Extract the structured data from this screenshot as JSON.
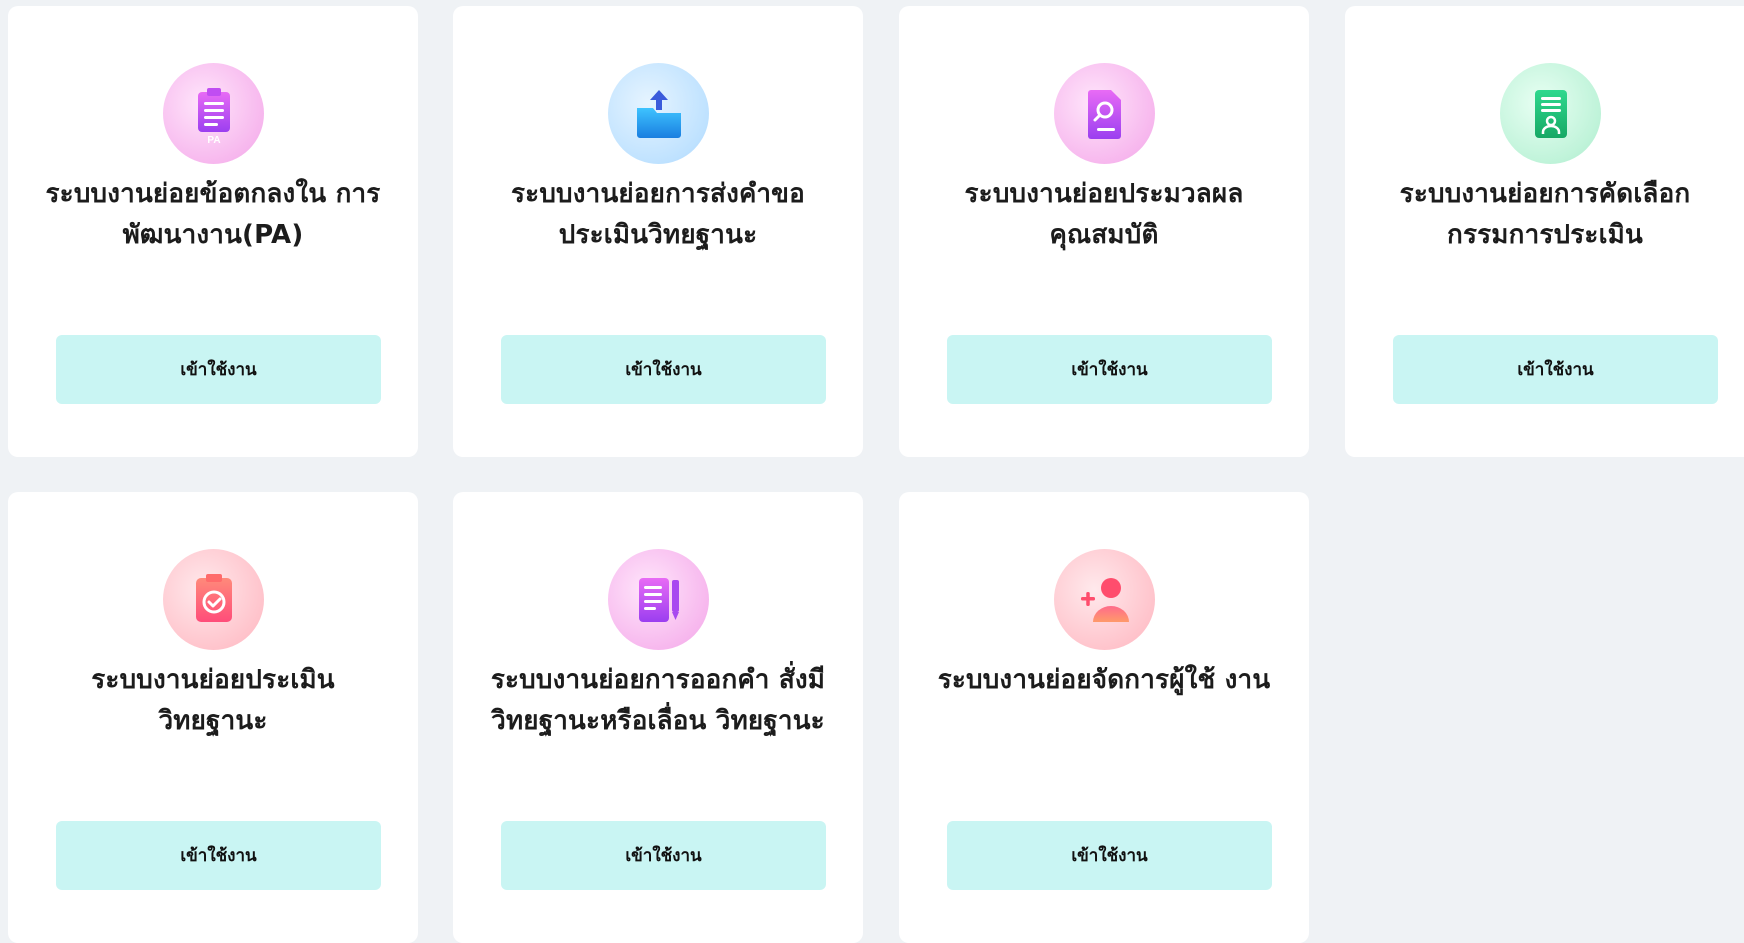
{
  "cards": [
    {
      "title": "ระบบงานย่อยข้อตกลงใน การพัฒนางาน(PA)",
      "button_label": "เข้าใช้งาน",
      "icon": "clipboard-pa-icon",
      "icon_badge": "PA"
    },
    {
      "title": "ระบบงานย่อยการส่งคำขอ ประเมินวิทยฐานะ",
      "button_label": "เข้าใช้งาน",
      "icon": "folder-upload-icon"
    },
    {
      "title": "ระบบงานย่อยประมวลผล คุณสมบัติ",
      "button_label": "เข้าใช้งาน",
      "icon": "document-search-icon"
    },
    {
      "title": "ระบบงานย่อยการคัดเลือก กรรมการประเมิน",
      "button_label": "เข้าใช้งาน",
      "icon": "id-document-icon"
    },
    {
      "title": "ระบบงานย่อยประเมิน วิทยฐานะ",
      "button_label": "เข้าใช้งาน",
      "icon": "clipboard-check-icon"
    },
    {
      "title": "ระบบงานย่อยการออกคำ สั่งมีวิทยฐานะหรือเลื่อน วิทยฐานะ",
      "button_label": "เข้าใช้งาน",
      "icon": "document-pen-icon"
    },
    {
      "title": "ระบบงานย่อยจัดการผู้ใช้ งาน",
      "button_label": "เข้าใช้งาน",
      "icon": "add-user-icon"
    }
  ],
  "colors": {
    "page_bg": "#eff2f5",
    "card_bg": "#ffffff",
    "button_bg": "#c9f5f3",
    "icon_purple": "#b44cf0",
    "icon_blue": "#1a9dea",
    "icon_green": "#22c57e",
    "icon_coral": "#ff5a6e"
  }
}
